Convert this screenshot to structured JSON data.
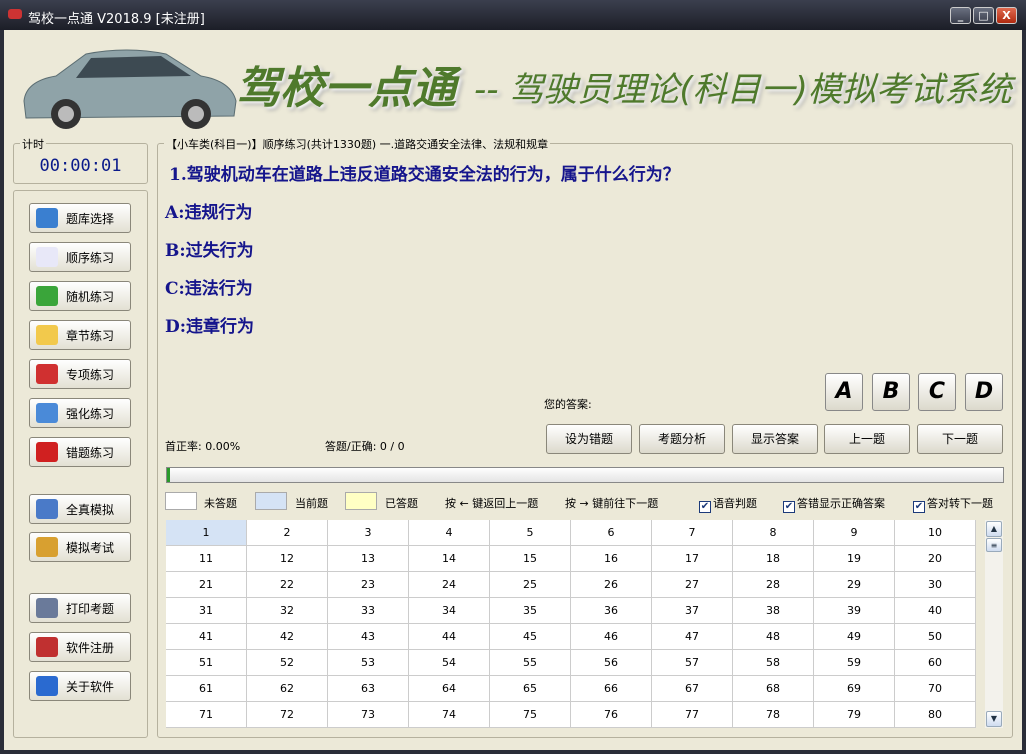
{
  "window": {
    "title": "驾校一点通 V2018.9 [未注册]",
    "minimize": "_",
    "maximize": "□",
    "close": "X"
  },
  "banner": {
    "brand": "驾校一点通",
    "subtitle": "-- 驾驶员理论(科目一)模拟考试系统"
  },
  "timer": {
    "label": "计时",
    "value": "00:00:01"
  },
  "sidebar": [
    {
      "label": "题库选择",
      "icon": "cubes-icon",
      "color": "#3a7fd0"
    },
    {
      "label": "顺序练习",
      "icon": "notepad-pencil-icon",
      "color": "#e8e8f8"
    },
    {
      "label": "随机练习",
      "icon": "refresh-icon",
      "color": "#3aa53a"
    },
    {
      "label": "章节练习",
      "icon": "folder-icon",
      "color": "#f2c94c"
    },
    {
      "label": "专项练习",
      "icon": "checklist-icon",
      "color": "#d03030"
    },
    {
      "label": "强化练习",
      "icon": "bar-chart-icon",
      "color": "#4a8ad8"
    },
    {
      "label": "错题练习",
      "icon": "flag-icon",
      "color": "#d02020"
    },
    {
      "label": "全真模拟",
      "icon": "window-grid-icon",
      "color": "#4a7ac8"
    },
    {
      "label": "模拟考试",
      "icon": "calendar-icon",
      "color": "#d8a030"
    },
    {
      "label": "打印考题",
      "icon": "printer-icon",
      "color": "#6a7a9a"
    },
    {
      "label": "软件注册",
      "icon": "wrench-icon",
      "color": "#c03030"
    },
    {
      "label": "关于软件",
      "icon": "info-icon",
      "color": "#2a6ad0"
    }
  ],
  "main": {
    "legend": "【小车类(科目一)】顺序练习(共计1330题) 一.道路交通安全法律、法规和规章",
    "question": "1.驾驶机动车在道路上违反道路交通安全法的行为，属于什么行为？",
    "options": [
      "A:违规行为",
      "B:过失行为",
      "C:违法行为",
      "D:违章行为"
    ],
    "your_answer_label": "您的答案:",
    "answer_buttons": [
      "A",
      "B",
      "C",
      "D"
    ],
    "first_rate": "首正率: 0.00%",
    "answered": "答题/正确: 0 / 0",
    "actions": [
      "设为错题",
      "考题分析",
      "显示答案",
      "上一题",
      "下一题"
    ],
    "progress": 0.003,
    "legend_items": [
      "未答题",
      "当前题",
      "已答题"
    ],
    "hint_prev": "按 ← 键返回上一题",
    "hint_next": "按 → 键前往下一题",
    "checks": [
      {
        "label": "语音判题",
        "checked": true
      },
      {
        "label": "答错显示正确答案",
        "checked": true
      },
      {
        "label": "答对转下一题",
        "checked": true
      }
    ],
    "current_question": 1,
    "grid_numbers": [
      1,
      2,
      3,
      4,
      5,
      6,
      7,
      8,
      9,
      10,
      11,
      12,
      13,
      14,
      15,
      16,
      17,
      18,
      19,
      20,
      21,
      22,
      23,
      24,
      25,
      26,
      27,
      28,
      29,
      30,
      31,
      32,
      33,
      34,
      35,
      36,
      37,
      38,
      39,
      40,
      41,
      42,
      43,
      44,
      45,
      46,
      47,
      48,
      49,
      50,
      51,
      52,
      53,
      54,
      55,
      56,
      57,
      58,
      59,
      60,
      61,
      62,
      63,
      64,
      65,
      66,
      67,
      68,
      69,
      70,
      71,
      72,
      73,
      74,
      75,
      76,
      77,
      78,
      79,
      80
    ]
  },
  "colors": {
    "current": "#d5e3f5",
    "answered": "#ffffc4",
    "unanswered": "#ffffff"
  }
}
